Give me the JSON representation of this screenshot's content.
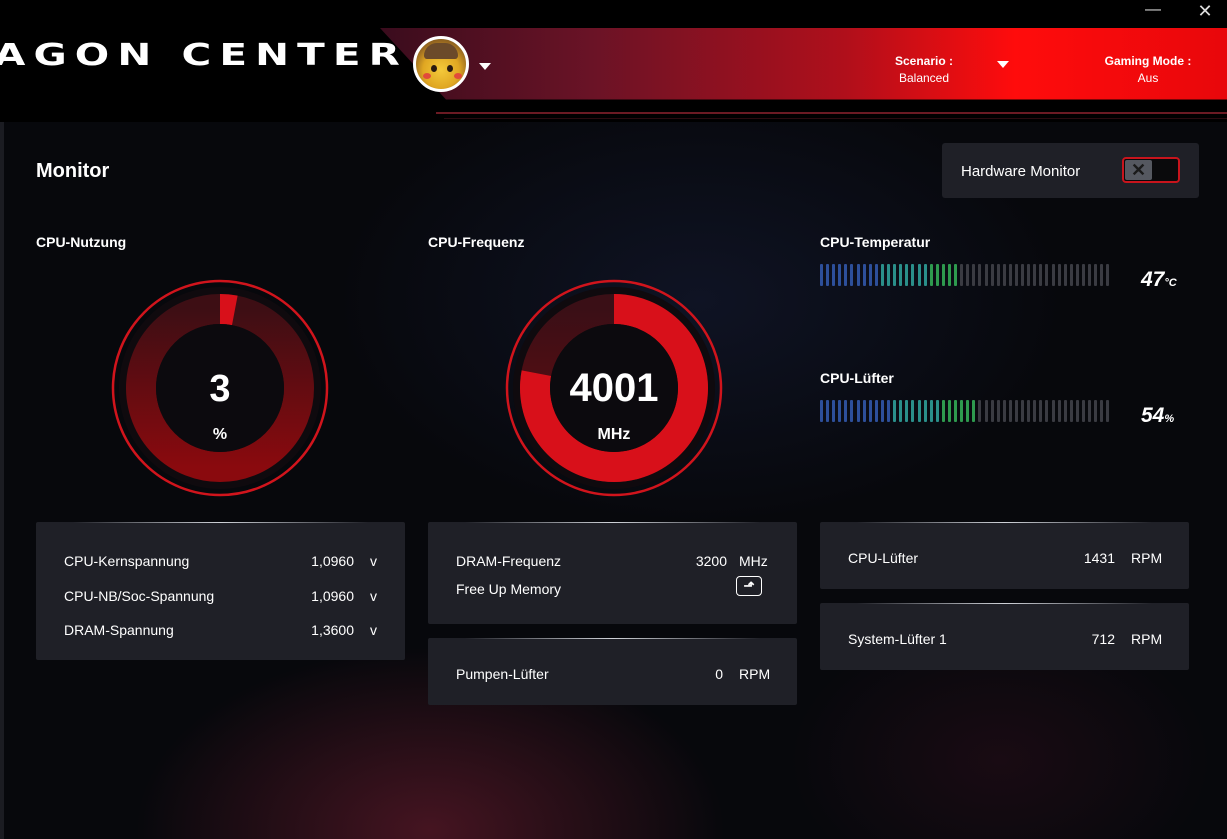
{
  "app": {
    "title": "AGON CENTER",
    "window_controls": {
      "minimize": "—",
      "close": "✕"
    }
  },
  "header": {
    "avatar_icon": "pikachu-detective-avatar",
    "scenario_label": "Scenario :",
    "scenario_value": "Balanced",
    "gaming_mode_label": "Gaming Mode :",
    "gaming_mode_value": "Aus"
  },
  "page": {
    "title": "Monitor",
    "hardware_monitor_label": "Hardware Monitor",
    "hardware_monitor_enabled": false
  },
  "cpu_usage": {
    "label": "CPU-Nutzung",
    "value": "3",
    "unit": "%",
    "fraction": 0.03
  },
  "cpu_freq": {
    "label": "CPU-Frequenz",
    "value": "4001",
    "unit": "MHz",
    "fraction": 0.78
  },
  "cpu_temp": {
    "label": "CPU-Temperatur",
    "value": "47",
    "unit": "°C",
    "fraction": 0.47
  },
  "cpu_fan": {
    "label": "CPU-Lüfter",
    "value": "54",
    "unit": "%",
    "fraction": 0.54
  },
  "voltages": [
    {
      "label": "CPU-Kernspannung",
      "value": "1,0960",
      "unit": "v"
    },
    {
      "label": "CPU-NB/Soc-Spannung",
      "value": "1,0960",
      "unit": "v"
    },
    {
      "label": "DRAM-Spannung",
      "value": "1,3600",
      "unit": "v"
    }
  ],
  "dram": {
    "freq_label": "DRAM-Frequenz",
    "freq_value": "3200",
    "freq_unit": "MHz",
    "free_up_label": "Free Up Memory",
    "free_up_icon": "arrow-up-icon"
  },
  "pump_fan": {
    "label": "Pumpen-Lüfter",
    "value": "0",
    "unit": "RPM"
  },
  "fans": [
    {
      "label": "CPU-Lüfter",
      "value": "1431",
      "unit": "RPM"
    },
    {
      "label": "System-Lüfter 1",
      "value": "712",
      "unit": "RPM"
    }
  ],
  "colors": {
    "accent_red": "#e0101a",
    "bar_blue": "#2d4f9a",
    "bar_teal": "#2a8f8a",
    "bar_green": "#2e9a4e",
    "bar_off": "#3a3b42"
  }
}
